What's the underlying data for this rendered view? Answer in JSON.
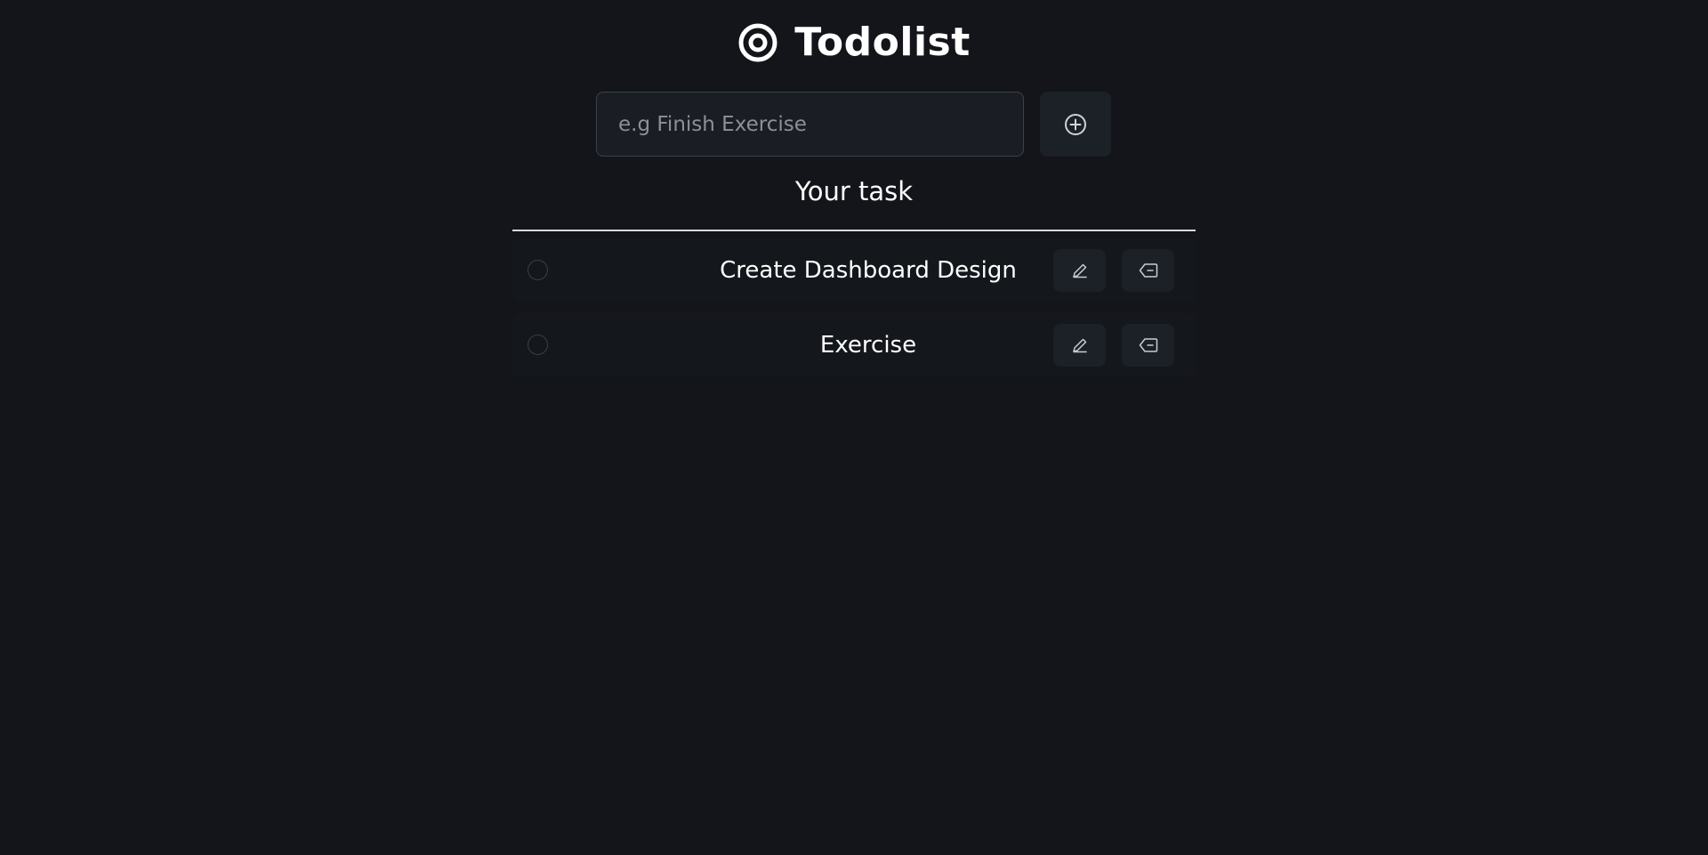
{
  "app": {
    "title": "Todolist"
  },
  "add_task": {
    "placeholder": "e.g Finish Exercise",
    "value": "",
    "add_icon": "plus-circle-icon"
  },
  "task_section": {
    "title": "Your task"
  },
  "tasks": [
    {
      "text": "Create Dashboard Design",
      "completed": false
    },
    {
      "text": "Exercise",
      "completed": false
    }
  ],
  "icons": {
    "logo": "target-icon",
    "edit": "pencil-icon",
    "delete": "backspace-icon"
  },
  "colors": {
    "background": "#13151a",
    "surface": "#1c2027",
    "input_border": "#3b414c",
    "text": "#ffffff",
    "placeholder": "#8b9099"
  }
}
